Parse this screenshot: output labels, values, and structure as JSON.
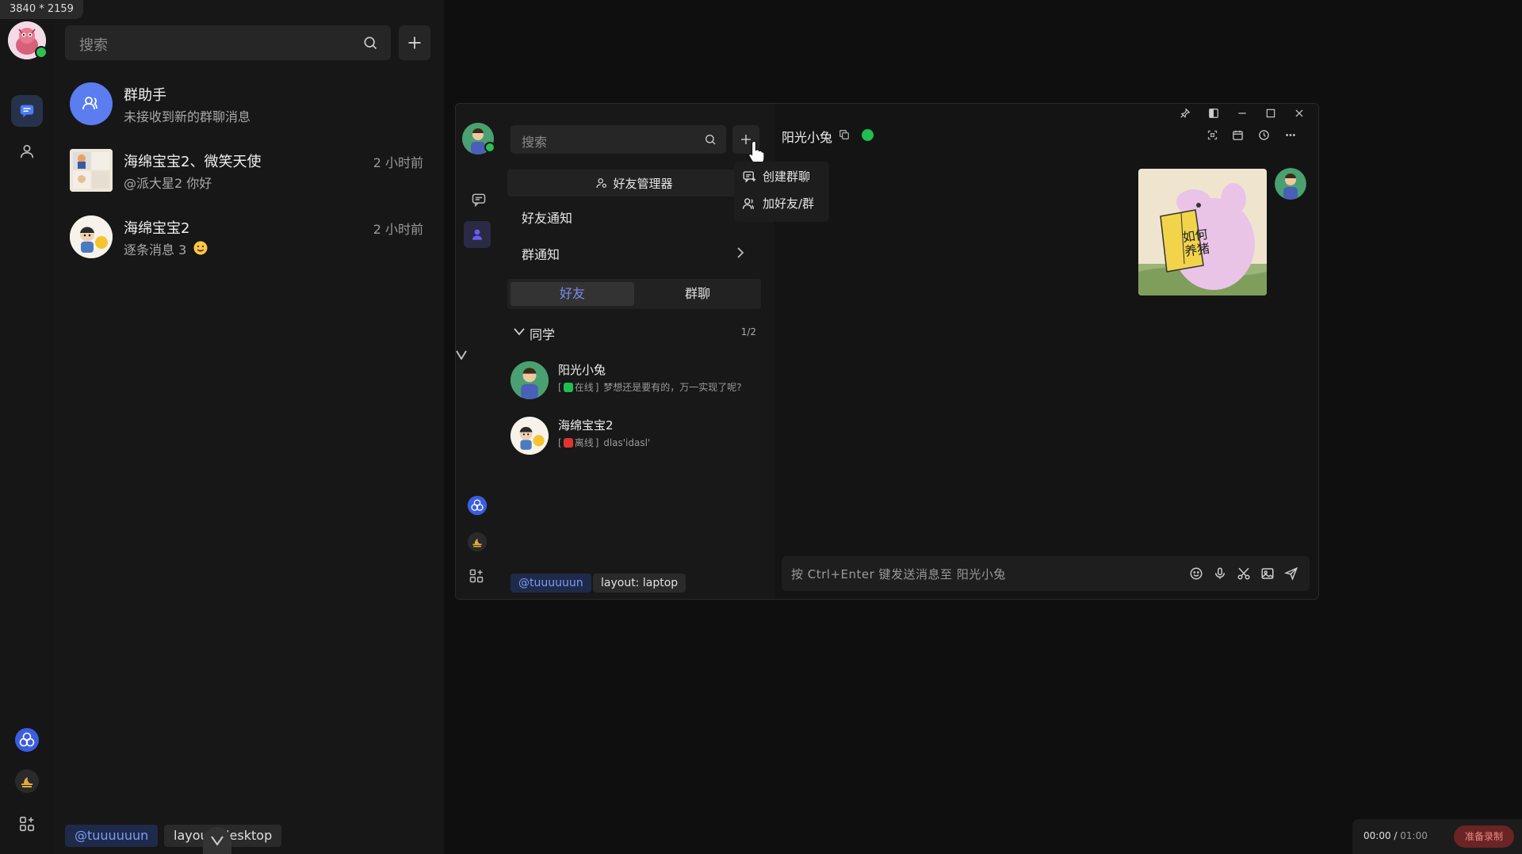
{
  "dimension_badge": "3840 * 2159",
  "app": {
    "search_placeholder": "搜索",
    "conversations": [
      {
        "name": "群助手",
        "subtitle": "未接收到新的群聊消息",
        "time": ""
      },
      {
        "name": "海绵宝宝2、微笑天使",
        "subtitle": "@派大星2 你好",
        "time": "2 小时前"
      },
      {
        "name": "海绵宝宝2",
        "subtitle": "逐条消息 3",
        "time": "2 小时前"
      }
    ],
    "footer_tags": [
      "@tuuuuuun",
      "layout: desktop"
    ]
  },
  "window": {
    "search_placeholder": "搜索",
    "friend_manager_label": "好友管理器",
    "friend_notice_label": "好友通知",
    "group_notice_label": "群通知",
    "tabs": [
      "好友",
      "群聊"
    ],
    "group": {
      "label": "同学",
      "count": "1/2"
    },
    "friends": [
      {
        "name": "阳光小兔",
        "status": "在线",
        "status_color": "#1fbf52",
        "signature": "梦想还是要有的，万一实现了呢?"
      },
      {
        "name": "海绵宝宝2",
        "status": "离线",
        "status_color": "#e03434",
        "signature": "dlas'idasl'"
      }
    ],
    "dropdown": [
      "创建群聊",
      "加好友/群"
    ],
    "chat_title": "阳光小兔",
    "sticker_text": "如何养猪",
    "input_placeholder": "按 Ctrl+Enter 键发送消息至 阳光小兔",
    "footer_tags": [
      "@tuuuuuun",
      "layout: laptop"
    ]
  },
  "recorder": {
    "time_current": "00:00",
    "time_total": "01:00",
    "button": "准备录制"
  },
  "colors": {
    "online": "#2fbf52",
    "accent": "#7d8cf0",
    "rail_active": "#25324a"
  }
}
